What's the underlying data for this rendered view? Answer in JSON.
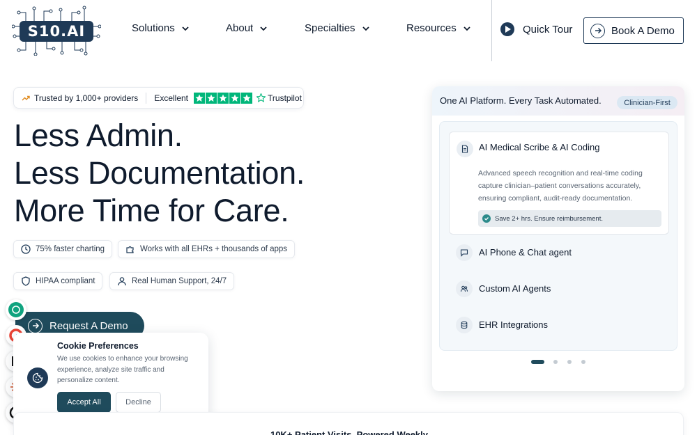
{
  "logo": {
    "text": "S10.AI"
  },
  "nav": {
    "items": [
      {
        "label": "Solutions"
      },
      {
        "label": "About"
      },
      {
        "label": "Specialties"
      },
      {
        "label": "Resources"
      }
    ],
    "quick_tour": "Quick Tour",
    "book_demo": "Book A Demo"
  },
  "trust": {
    "trusted": "Trusted by 1,000+ providers",
    "rating_label": "Excellent",
    "stars": 5,
    "brand": "Trustpilot",
    "star_color": "#00b67a"
  },
  "hero": {
    "lines": [
      "Less Admin.",
      "Less Documentation.",
      "More Time for Care."
    ]
  },
  "features": [
    {
      "label": "75% faster charting",
      "icon": "clock-icon"
    },
    {
      "label": "Works with all EHRs + thousands of apps",
      "icon": "puzzle-icon"
    },
    {
      "label": "HIPAA compliant",
      "icon": "shield-icon"
    },
    {
      "label": "Real Human Support, 24/7",
      "icon": "user-icon"
    }
  ],
  "cta": {
    "request_demo": "Request A Demo"
  },
  "cookie": {
    "title": "Cookie Preferences",
    "text": "We use cookies to enhance your browsing experience, analyze site traffic and personalize content.",
    "accept": "Accept All",
    "decline": "Decline"
  },
  "bottom": {
    "title": "10K+ Patient Visits, Powered Weekly"
  },
  "panel": {
    "title": "One AI Platform. Every Task Automated.",
    "badge": "Clinician-First",
    "active": {
      "title": "AI Medical Scribe & AI Coding",
      "description": "Advanced speech recognition and real-time coding capture clinician–patient conversations accurately, ensuring compliant, audit-ready documentation.",
      "benefit": "Save 2+ hrs. Ensure reimbursement."
    },
    "items": [
      {
        "label": "AI Phone & Chat agent",
        "icon": "chat-icon"
      },
      {
        "label": "Custom AI Agents",
        "icon": "users-icon"
      },
      {
        "label": "EHR Integrations",
        "icon": "database-icon"
      }
    ],
    "carousel_pages": 4,
    "carousel_active": 1
  },
  "colors": {
    "brand_dark": "#1f3a57",
    "cta": "#1f4b5c",
    "text": "#0f1b2d"
  }
}
